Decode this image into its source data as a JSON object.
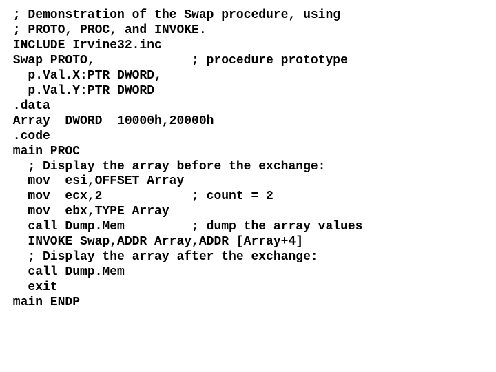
{
  "code": {
    "lines": [
      " ; Demonstration of the Swap procedure, using",
      " ; PROTO, PROC, and INVOKE.",
      " INCLUDE Irvine32.inc",
      " Swap PROTO,             ; procedure prototype",
      "   p.Val.X:PTR DWORD,",
      "   p.Val.Y:PTR DWORD",
      " .data",
      " Array  DWORD  10000h,20000h",
      " .code",
      " main PROC",
      "   ; Display the array before the exchange:",
      "   mov  esi,OFFSET Array",
      "   mov  ecx,2            ; count = 2",
      "   mov  ebx,TYPE Array",
      "   call Dump.Mem         ; dump the array values",
      "   INVOKE Swap,ADDR Array,ADDR [Array+4]",
      "   ; Display the array after the exchange:",
      "   call Dump.Mem",
      "   exit",
      " main ENDP"
    ]
  }
}
